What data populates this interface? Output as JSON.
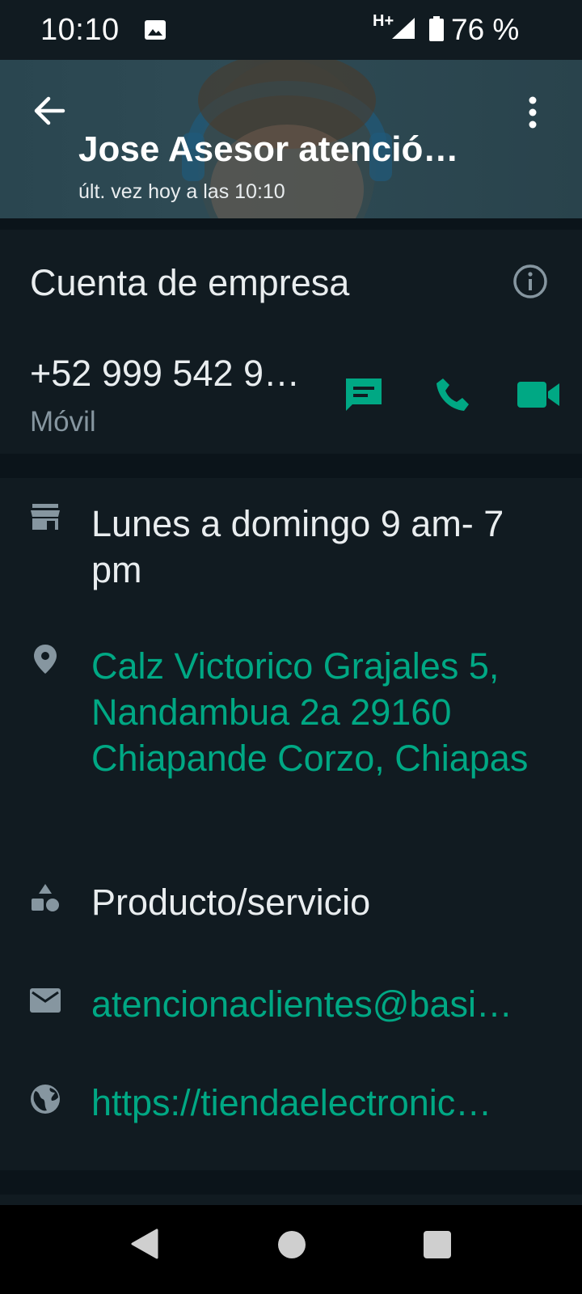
{
  "status_bar": {
    "time": "10:10",
    "network": "H+",
    "battery": "76 %",
    "icons": [
      "image-icon",
      "signal-icon",
      "battery-icon"
    ]
  },
  "header": {
    "name": "Jose Asesor atenció…",
    "last_seen": "últ. vez hoy a las 10:10",
    "icons": [
      "back-arrow-icon",
      "more-options-icon"
    ]
  },
  "business": {
    "title": "Cuenta de empresa",
    "phone": "+52 999 542 9…",
    "phone_type": "Móvil",
    "actions": [
      "message-icon",
      "call-icon",
      "video-call-icon"
    ]
  },
  "details": {
    "hours": "Lunes a domingo 9  am- 7 pm",
    "address": "Calz Victorico Grajales 5, Nandambua 2a 29160 Chiapande Corzo, Chiapas",
    "category": "Producto/servicio",
    "email": "atencionaclientes@basi…",
    "website": "https://tiendaelectronic…"
  },
  "colors": {
    "accent": "#00a884",
    "background": "#111b21",
    "text_primary": "#e9edef",
    "text_secondary": "#8696a0"
  }
}
